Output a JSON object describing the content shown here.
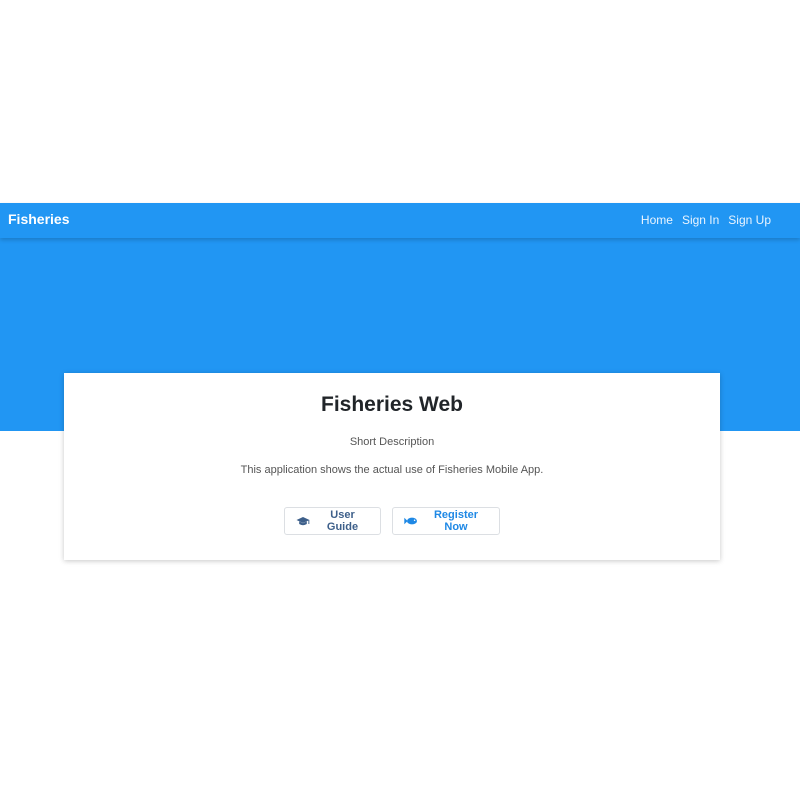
{
  "navbar": {
    "brand": "Fisheries",
    "links": [
      {
        "label": "Home"
      },
      {
        "label": "Sign In"
      },
      {
        "label": "Sign Up"
      }
    ]
  },
  "card": {
    "title": "Fisheries Web",
    "subtitle": "Short Description",
    "description": "This application shows the actual use of Fisheries Mobile App.",
    "buttons": [
      {
        "label": "User Guide",
        "icon": "graduation-cap-icon"
      },
      {
        "label": "Register Now",
        "icon": "fish-icon"
      }
    ]
  },
  "colors": {
    "primary": "#2196f3",
    "link": "#1e88e5",
    "guide_text": "#3d5f8a",
    "text": "#212529"
  }
}
